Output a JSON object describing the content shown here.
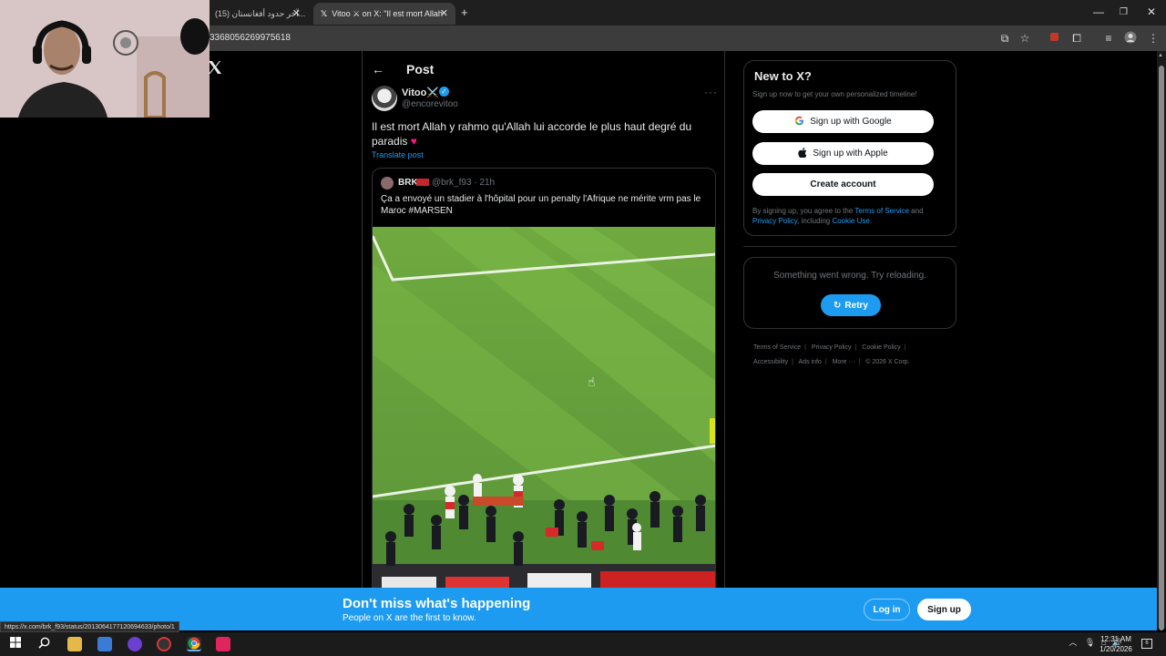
{
  "browser": {
    "tabs": [
      {
        "title": "(15) آخر حدود أفغانستان..."
      },
      {
        "title": "Vitoo ⚔ on X: \"Il est mort Allah"
      }
    ],
    "new_tab": "+",
    "url": "3368056269975618",
    "status_url": "https://x.com/brk_f93/status/2013064177120694633/photo/1"
  },
  "post": {
    "header_title": "Post",
    "author_name": "Vitoo⚔️",
    "author_handle": "@encorevitoo",
    "text": "Il est mort Allah y rahmo qu'Allah lui accorde le plus haut degré du paradis",
    "heart": "♥",
    "translate_label": "Translate post",
    "more": "···"
  },
  "quote": {
    "name": "BRK",
    "handle_time": "@brk_f93 · 21h",
    "text": "Ça a envoyé un stadier à l'hôpital pour un penalty l'Afrique ne mérite vrm pas le Maroc #MARSEN"
  },
  "sidebar": {
    "new_to_x_title": "New to X?",
    "new_to_x_sub": "Sign up now to get your own personalized timeline!",
    "google_label": "Sign up with Google",
    "apple_label": "Sign up with Apple",
    "create_label": "Create account",
    "legal_prefix": "By signing up, you agree to the ",
    "terms_link": "Terms of Service",
    "legal_and": " and ",
    "privacy_link": "Privacy Policy",
    "legal_including": ", including ",
    "cookie_link": "Cookie Use",
    "legal_end": ".",
    "error_text": "Something went wrong. Try reloading.",
    "retry_label": "Retry",
    "footer": {
      "terms": "Terms of Service",
      "privacy": "Privacy Policy",
      "cookie": "Cookie Policy",
      "accessibility": "Accessibility",
      "ads": "Ads info",
      "more": "More ···",
      "copyright": "© 2026 X Corp."
    }
  },
  "banner": {
    "title": "Don't miss what's happening",
    "subtitle": "People on X are the first to know.",
    "login_label": "Log in",
    "signup_label": "Sign up"
  },
  "taskbar": {
    "time": "12:31 AM",
    "date": "1/20/2026",
    "notif_count": "6"
  },
  "colors": {
    "accent": "#1d9bf0",
    "background": "#000000",
    "border": "#2f3336",
    "muted": "#71767b"
  }
}
